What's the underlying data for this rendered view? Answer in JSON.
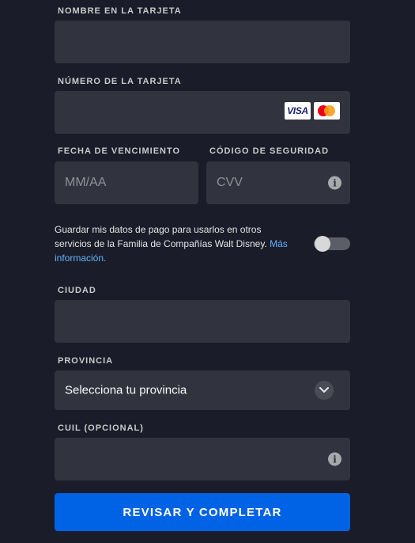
{
  "name_on_card": {
    "label": "NOMBRE EN LA TARJETA",
    "value": ""
  },
  "card_number": {
    "label": "NÚMERO DE LA TARJETA",
    "value": "",
    "brands": [
      "VISA",
      "mastercard"
    ]
  },
  "expiry": {
    "label": "FECHA DE VENCIMIENTO",
    "placeholder": "MM/AA"
  },
  "security_code": {
    "label": "CÓDIGO DE SEGURIDAD",
    "placeholder": "CVV"
  },
  "save_consent": {
    "text": "Guardar mis datos de pago para usarlos en otros servicios de la Familia de Compañías Walt Disney.",
    "link": "Más información.",
    "toggle_on": false
  },
  "city": {
    "label": "CIUDAD",
    "value": ""
  },
  "province": {
    "label": "PROVINCIA",
    "selected": "Selecciona tu provincia"
  },
  "cuil": {
    "label": "CUIL (OPCIONAL)",
    "value": ""
  },
  "submit": {
    "label": "REVISAR Y COMPLETAR"
  },
  "colors": {
    "accent": "#0063e5",
    "link": "#62b4ff",
    "background": "#1a1c29",
    "field": "#31343e"
  }
}
